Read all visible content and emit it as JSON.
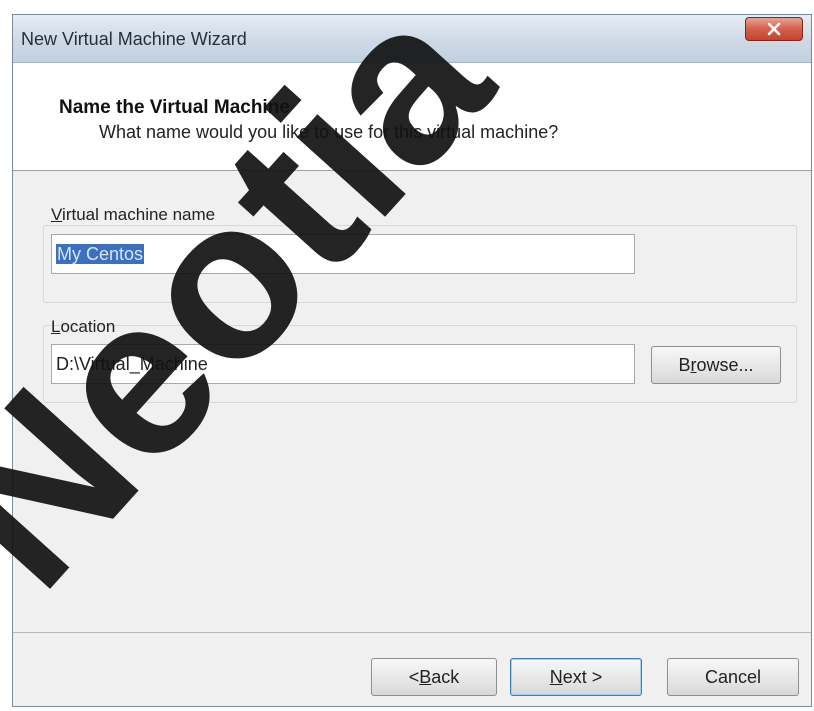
{
  "window": {
    "title": "New Virtual Machine Wizard"
  },
  "header": {
    "title": "Name the Virtual Machine",
    "subtitle": "What name would you like to use for this virtual machine?"
  },
  "name_group": {
    "label_accel": "V",
    "label_rest": "irtual machine name",
    "value": "My Centos"
  },
  "location_group": {
    "label_accel": "L",
    "label_rest": "ocation",
    "value": "D:\\Virtual_Machine",
    "browse_pre": "B",
    "browse_accel": "r",
    "browse_post": "owse..."
  },
  "footer": {
    "back_pre": "< ",
    "back_accel": "B",
    "back_post": "ack",
    "next_accel": "N",
    "next_post": "ext >",
    "cancel_label": "Cancel"
  },
  "watermark": {
    "text": "Neotia"
  },
  "colors": {
    "selection": "#3b6fbf",
    "close_button": "#c94a35",
    "watermark": "#111111"
  },
  "icons": {
    "close": "close-x-icon"
  }
}
